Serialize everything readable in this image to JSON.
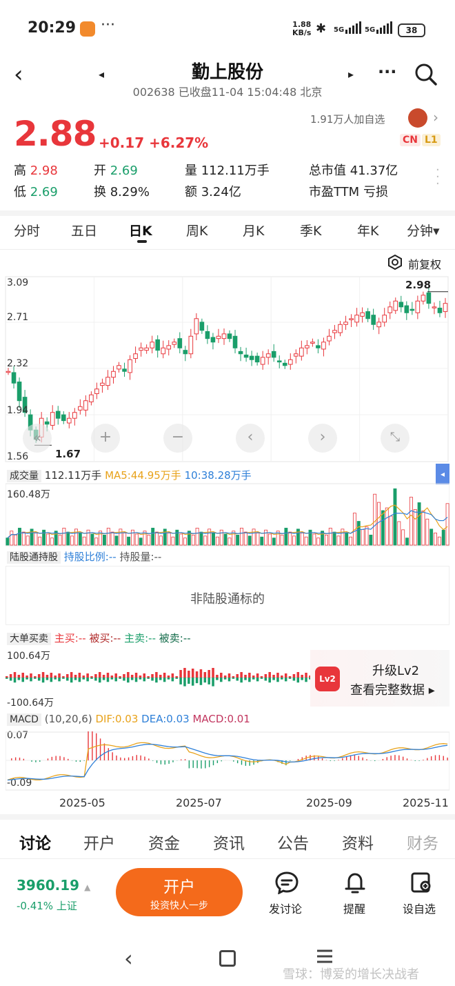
{
  "status_bar": {
    "time": "20:29",
    "dots": "···",
    "speed_value": "1.88",
    "speed_unit": "KB/s",
    "sig1": "5G",
    "sig2": "5G",
    "battery": "38"
  },
  "header": {
    "title": "勤上股份",
    "subtitle": "002638 已收盘11-04 15:04:48 北京",
    "more": "···"
  },
  "quote": {
    "price": "2.88",
    "change": "+0.17 +6.27%",
    "followers": "1.91万人加自选",
    "tag_cn": "CN",
    "tag_l1": "L1",
    "stats": [
      {
        "label": "高",
        "value": "2.98"
      },
      {
        "label": "开",
        "value": "2.69"
      },
      {
        "label": "量",
        "value": "112.11万手"
      },
      {
        "label": "总市值",
        "value": "41.37亿"
      },
      {
        "label": "低",
        "value": "2.69"
      },
      {
        "label": "换",
        "value": "8.29%"
      },
      {
        "label": "额",
        "value": "3.24亿"
      },
      {
        "label": "市盈TTM",
        "value": "亏损"
      }
    ]
  },
  "chart_tabs": [
    "分时",
    "五日",
    "日K",
    "周K",
    "月K",
    "季K",
    "年K",
    "分钟▾"
  ],
  "active_tab": "日K",
  "adjust_label": "前复权",
  "kline": {
    "y_ticks": [
      "3.09",
      "2.71",
      "2.32",
      "1.94",
      "1.56"
    ],
    "high_marker": "2.98",
    "low_marker": "1.67"
  },
  "volume": {
    "label": "成交量",
    "value": "112.11万手",
    "ma5": "MA5:44.95万手",
    "ma10": "10:38.28万手",
    "max": "160.48万"
  },
  "hk_connect": {
    "label": "陆股通持股",
    "ratio": "持股比例:--",
    "amount": "持股量:--",
    "message": "非陆股通标的"
  },
  "big_order": {
    "label": "大单买卖",
    "zhu_mai": "主买:--",
    "bei_mai": "被买:--",
    "zhu_mai2": "主卖:--",
    "bei_mai2": "被卖:--",
    "top": "100.64万",
    "bottom": "-100.64万",
    "lv2_badge": "Lv2",
    "upgrade": "升级Lv2",
    "view_full": "查看完整数据 ▸"
  },
  "macd": {
    "label": "MACD",
    "params": "(10,20,6)",
    "dif": "DIF:0.03",
    "dea": "DEA:0.03",
    "macd": "MACD:0.01",
    "top": "0.07",
    "bottom": "-0.09"
  },
  "x_axis": [
    "2025-05",
    "2025-07",
    "2025-09",
    "2025-11"
  ],
  "bottom_tabs": [
    "讨论",
    "开户",
    "资金",
    "资讯",
    "公告",
    "资料",
    "财务"
  ],
  "footer": {
    "index_value": "3960.19",
    "index_change": "-0.41% 上证",
    "open_title": "开户",
    "open_sub": "投资快人一步",
    "discuss": "发讨论",
    "alert": "提醒",
    "watch": "设自选"
  },
  "watermark": "雪球：博爱的增长决战者",
  "colors": {
    "up": "#e8363b",
    "down": "#1a9e6a",
    "accent": "#f46a1b"
  },
  "chart_data": {
    "type": "candlestick",
    "x": [
      "2025-05",
      "2025-07",
      "2025-09",
      "2025-11"
    ],
    "ylim": [
      1.56,
      3.09
    ],
    "close_approx": [
      2.3,
      2.2,
      2.05,
      1.95,
      1.8,
      1.72,
      1.9,
      1.85,
      1.95,
      1.9,
      1.88,
      1.9,
      1.95,
      2.0,
      2.05,
      2.1,
      2.15,
      2.2,
      2.25,
      2.3,
      2.35,
      2.3,
      2.4,
      2.45,
      2.5,
      2.5,
      2.55,
      2.48,
      2.5,
      2.52,
      2.55,
      2.5,
      2.45,
      2.6,
      2.75,
      2.65,
      2.58,
      2.55,
      2.6,
      2.62,
      2.58,
      2.5,
      2.45,
      2.42,
      2.4,
      2.38,
      2.42,
      2.45,
      2.42,
      2.38,
      2.35,
      2.4,
      2.45,
      2.5,
      2.52,
      2.55,
      2.5,
      2.55,
      2.6,
      2.65,
      2.7,
      2.72,
      2.75,
      2.78,
      2.8,
      2.75,
      2.7,
      2.72,
      2.78,
      2.85,
      2.9,
      2.85,
      2.8,
      2.82,
      2.9,
      2.95,
      2.88,
      2.85,
      2.8,
      2.88
    ]
  }
}
